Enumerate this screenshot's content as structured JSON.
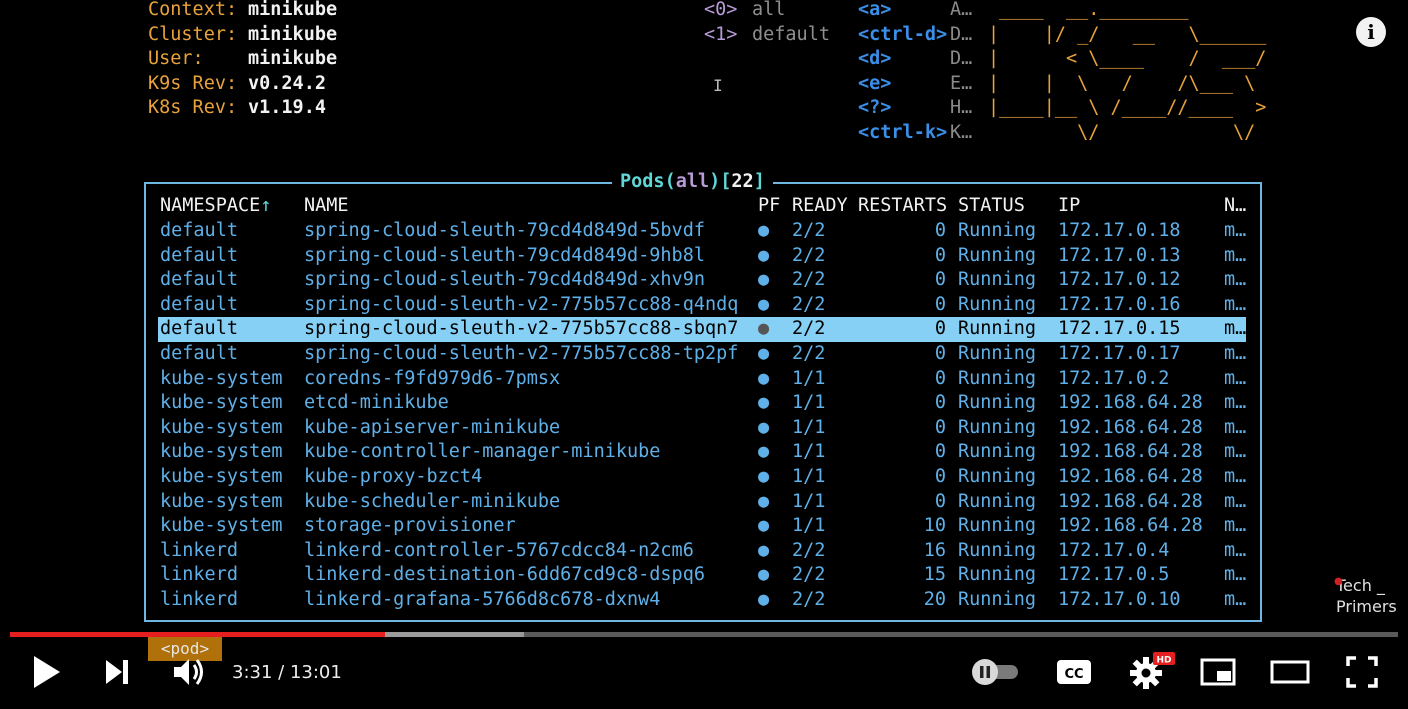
{
  "header": {
    "info": [
      {
        "key": "Context:",
        "value": "minikube"
      },
      {
        "key": "Cluster:",
        "value": "minikube"
      },
      {
        "key": "User:",
        "value": "minikube"
      },
      {
        "key": "K9s Rev:",
        "value": "v0.24.2"
      },
      {
        "key": "K8s Rev:",
        "value": "v1.19.4"
      }
    ],
    "namespaces": [
      {
        "key": "<0>",
        "value": "all"
      },
      {
        "key": "<1>",
        "value": "default"
      }
    ],
    "hotkeys": [
      {
        "key": "<a>",
        "desc": "A…"
      },
      {
        "key": "<ctrl-d>",
        "desc": "D…"
      },
      {
        "key": "<d>",
        "desc": "D…"
      },
      {
        "key": "<e>",
        "desc": "E…"
      },
      {
        "key": "<?>",
        "desc": "H…"
      },
      {
        "key": "<ctrl-k>",
        "desc": "K…"
      }
    ],
    "logo_ascii": " ____  __.________       \n|    |/ _/   __   \\______\n|      < \\____    /  ___/\n|    |  \\   /    /\\___ \\ \n|____|__ \\ /____//____  >\n        \\/            \\/ "
  },
  "table": {
    "title": "Pods",
    "filter": "all",
    "count": "22",
    "columns": {
      "namespace": "NAMESPACE",
      "sort_arrow": "↑",
      "name": "NAME",
      "pf": "PF",
      "ready": "READY",
      "restarts": "RESTARTS",
      "status": "STATUS",
      "ip": "IP",
      "node": "N…"
    },
    "rows": [
      {
        "namespace": "default",
        "name": "spring-cloud-sleuth-79cd4d849d-5bvdf",
        "pf": "●",
        "ready": "2/2",
        "restarts": "0",
        "status": "Running",
        "ip": "172.17.0.18",
        "node": "m…"
      },
      {
        "namespace": "default",
        "name": "spring-cloud-sleuth-79cd4d849d-9hb8l",
        "pf": "●",
        "ready": "2/2",
        "restarts": "0",
        "status": "Running",
        "ip": "172.17.0.13",
        "node": "m…"
      },
      {
        "namespace": "default",
        "name": "spring-cloud-sleuth-79cd4d849d-xhv9n",
        "pf": "●",
        "ready": "2/2",
        "restarts": "0",
        "status": "Running",
        "ip": "172.17.0.12",
        "node": "m…"
      },
      {
        "namespace": "default",
        "name": "spring-cloud-sleuth-v2-775b57cc88-q4ndq",
        "pf": "●",
        "ready": "2/2",
        "restarts": "0",
        "status": "Running",
        "ip": "172.17.0.16",
        "node": "m…"
      },
      {
        "namespace": "default",
        "name": "spring-cloud-sleuth-v2-775b57cc88-sbqn7",
        "pf": "●",
        "ready": "2/2",
        "restarts": "0",
        "status": "Running",
        "ip": "172.17.0.15",
        "node": "m…",
        "selected": true
      },
      {
        "namespace": "default",
        "name": "spring-cloud-sleuth-v2-775b57cc88-tp2pf",
        "pf": "●",
        "ready": "2/2",
        "restarts": "0",
        "status": "Running",
        "ip": "172.17.0.17",
        "node": "m…"
      },
      {
        "namespace": "kube-system",
        "name": "coredns-f9fd979d6-7pmsx",
        "pf": "●",
        "ready": "1/1",
        "restarts": "0",
        "status": "Running",
        "ip": "172.17.0.2",
        "node": "m…"
      },
      {
        "namespace": "kube-system",
        "name": "etcd-minikube",
        "pf": "●",
        "ready": "1/1",
        "restarts": "0",
        "status": "Running",
        "ip": "192.168.64.28",
        "node": "m…"
      },
      {
        "namespace": "kube-system",
        "name": "kube-apiserver-minikube",
        "pf": "●",
        "ready": "1/1",
        "restarts": "0",
        "status": "Running",
        "ip": "192.168.64.28",
        "node": "m…"
      },
      {
        "namespace": "kube-system",
        "name": "kube-controller-manager-minikube",
        "pf": "●",
        "ready": "1/1",
        "restarts": "0",
        "status": "Running",
        "ip": "192.168.64.28",
        "node": "m…"
      },
      {
        "namespace": "kube-system",
        "name": "kube-proxy-bzct4",
        "pf": "●",
        "ready": "1/1",
        "restarts": "0",
        "status": "Running",
        "ip": "192.168.64.28",
        "node": "m…"
      },
      {
        "namespace": "kube-system",
        "name": "kube-scheduler-minikube",
        "pf": "●",
        "ready": "1/1",
        "restarts": "0",
        "status": "Running",
        "ip": "192.168.64.28",
        "node": "m…"
      },
      {
        "namespace": "kube-system",
        "name": "storage-provisioner",
        "pf": "●",
        "ready": "1/1",
        "restarts": "10",
        "status": "Running",
        "ip": "192.168.64.28",
        "node": "m…"
      },
      {
        "namespace": "linkerd",
        "name": "linkerd-controller-5767cdcc84-n2cm6",
        "pf": "●",
        "ready": "2/2",
        "restarts": "16",
        "status": "Running",
        "ip": "172.17.0.4",
        "node": "m…"
      },
      {
        "namespace": "linkerd",
        "name": "linkerd-destination-6dd67cd9c8-dspq6",
        "pf": "●",
        "ready": "2/2",
        "restarts": "15",
        "status": "Running",
        "ip": "172.17.0.5",
        "node": "m…"
      },
      {
        "namespace": "linkerd",
        "name": "linkerd-grafana-5766d8c678-dxnw4",
        "pf": "●",
        "ready": "2/2",
        "restarts": "20",
        "status": "Running",
        "ip": "172.17.0.10",
        "node": "m…"
      }
    ]
  },
  "crumb": "<pod>",
  "watermark": {
    "line1": "Tech _",
    "line2": "Primers"
  },
  "player": {
    "current_time": "3:31",
    "separator": " / ",
    "duration": "13:01",
    "played_fraction": 0.27,
    "buffered_fraction": 0.37,
    "hd_badge": "HD",
    "cc_label": "CC",
    "info_label": "i",
    "icons": [
      "play-icon",
      "next-icon",
      "volume-icon",
      "autoplay-toggle-icon",
      "cc-icon",
      "settings-icon",
      "miniplayer-icon",
      "theater-icon",
      "fullscreen-icon",
      "info-icon"
    ]
  },
  "colors": {
    "accent_orange": "#e8a23c",
    "table_text": "#5fb0e8",
    "selected_row": "#86d0f5",
    "hotkey": "#3a8fe8",
    "progress_red": "#e51f1f"
  }
}
